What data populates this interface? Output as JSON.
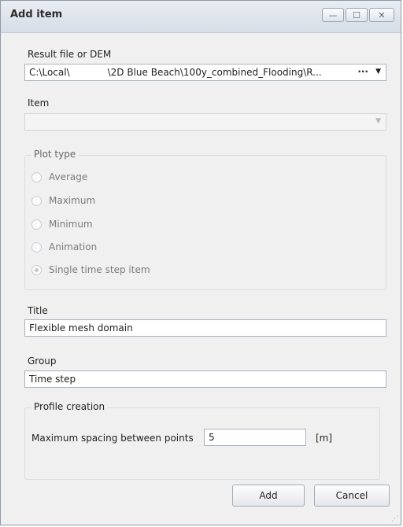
{
  "window": {
    "title": "Add item",
    "controls": {
      "minimize": "—",
      "maximize": "☐",
      "close": "✕"
    }
  },
  "result_file": {
    "label": "Result file or DEM",
    "value": "C:\\Local\\    \\2D Blue Beach\\100y_combined_Flooding\\R...",
    "browse": "···",
    "arrow": "▼"
  },
  "item": {
    "label": "Item",
    "value": "",
    "arrow": "▼"
  },
  "plot_type": {
    "label": "Plot type",
    "options": [
      {
        "label": "Average",
        "checked": false
      },
      {
        "label": "Maximum",
        "checked": false
      },
      {
        "label": "Minimum",
        "checked": false
      },
      {
        "label": "Animation",
        "checked": false
      },
      {
        "label": "Single time step item",
        "checked": true
      }
    ]
  },
  "title_field": {
    "label": "Title",
    "value": "Flexible mesh domain"
  },
  "group_field": {
    "label": "Group",
    "value": "Time step"
  },
  "profile_creation": {
    "label": "Profile creation",
    "spacing_label": "Maximum spacing between points",
    "spacing_value": "5",
    "unit": "[m]"
  },
  "buttons": {
    "add": "Add",
    "cancel": "Cancel"
  },
  "resize_grip": "⋰"
}
